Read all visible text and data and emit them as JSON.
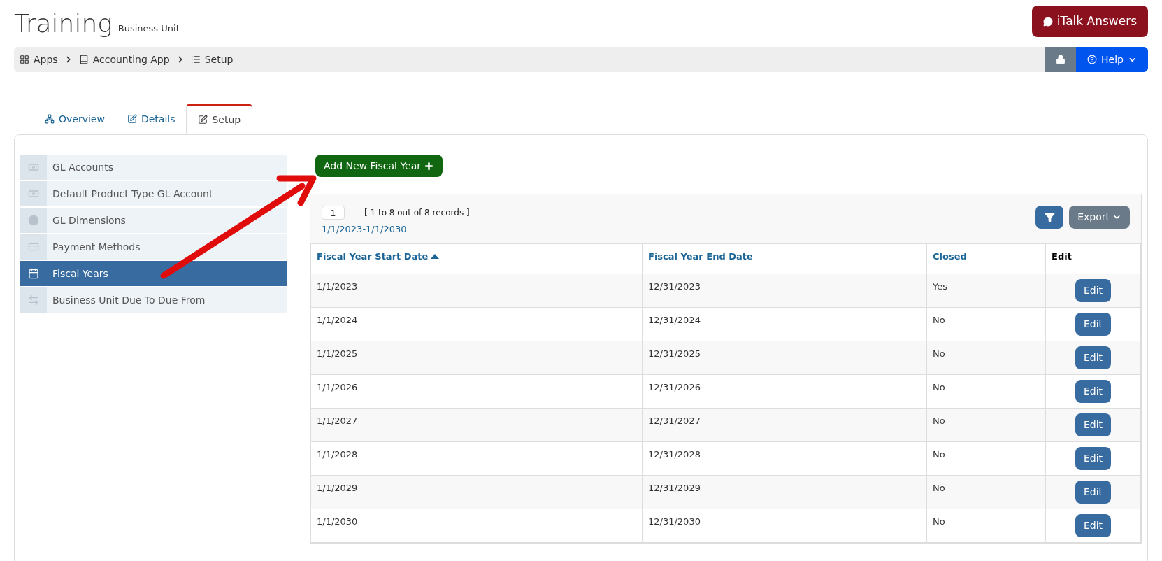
{
  "header": {
    "title": "Training",
    "subtitle": "Business Unit",
    "help_button": "iTalk Answers"
  },
  "breadcrumb": [
    "Apps",
    "Accounting App",
    "Setup"
  ],
  "help_menu": "Help",
  "tabs": [
    {
      "label": "Overview",
      "selected": false
    },
    {
      "label": "Details",
      "selected": false
    },
    {
      "label": "Setup",
      "selected": true
    }
  ],
  "sidebar": {
    "items": [
      {
        "label": "GL Accounts",
        "selected": false
      },
      {
        "label": "Default Product Type GL Account",
        "selected": false
      },
      {
        "label": "GL Dimensions",
        "selected": false
      },
      {
        "label": "Payment Methods",
        "selected": false
      },
      {
        "label": "Fiscal Years",
        "selected": true
      },
      {
        "label": "Business Unit Due To Due From",
        "selected": false
      }
    ]
  },
  "add_button": "Add New Fiscal Year",
  "table": {
    "page": "1",
    "records": "[ 1 to 8 out of 8 records ]",
    "range_link": "1/1/2023-1/1/2030",
    "export": "Export",
    "columns": [
      {
        "label": "Fiscal Year Start Date",
        "sortable": true,
        "sorted": true
      },
      {
        "label": "Fiscal Year End Date",
        "sortable": true,
        "sorted": false
      },
      {
        "label": "Closed",
        "sortable": true,
        "sorted": false
      },
      {
        "label": "Edit",
        "sortable": false,
        "sorted": false
      }
    ],
    "rows": [
      {
        "start": "1/1/2023",
        "end": "12/31/2023",
        "closed": "Yes",
        "action": "Edit"
      },
      {
        "start": "1/1/2024",
        "end": "12/31/2024",
        "closed": "No",
        "action": "Edit"
      },
      {
        "start": "1/1/2025",
        "end": "12/31/2025",
        "closed": "No",
        "action": "Edit"
      },
      {
        "start": "1/1/2026",
        "end": "12/31/2026",
        "closed": "No",
        "action": "Edit"
      },
      {
        "start": "1/1/2027",
        "end": "12/31/2027",
        "closed": "No",
        "action": "Edit"
      },
      {
        "start": "1/1/2028",
        "end": "12/31/2028",
        "closed": "No",
        "action": "Edit"
      },
      {
        "start": "1/1/2029",
        "end": "12/31/2029",
        "closed": "No",
        "action": "Edit"
      },
      {
        "start": "1/1/2030",
        "end": "12/31/2030",
        "closed": "No",
        "action": "Edit"
      }
    ]
  }
}
